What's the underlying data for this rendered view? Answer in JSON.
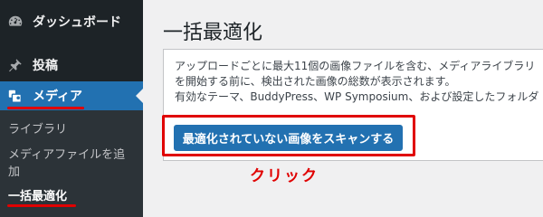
{
  "sidebar": {
    "items": [
      {
        "label": "ダッシュボード",
        "icon": "dashboard-icon"
      },
      {
        "label": "投稿",
        "icon": "pin-icon"
      },
      {
        "label": "メディア",
        "icon": "media-icon",
        "active": true
      }
    ],
    "submenu": [
      {
        "label": "ライブラリ"
      },
      {
        "label": "メディアファイルを追加"
      },
      {
        "label": "一括最適化",
        "current": true
      }
    ]
  },
  "main": {
    "title": "一括最適化",
    "description_lines": [
      "アップロードごとに最大11個の画像ファイルを含む、メディアライブラリ",
      "を開始する前に、検出された画像の総数が表示されます。",
      "有効なテーマ、BuddyPress、WP Symposium、および設定したフォルダ"
    ],
    "scan_button_label": "最適化されていない画像をスキャンする"
  },
  "annotation": {
    "click_label": "クリック",
    "color": "#e00000"
  },
  "colors": {
    "sidebar_bg": "#1d2327",
    "submenu_bg": "#2c3338",
    "accent": "#2271b1"
  }
}
